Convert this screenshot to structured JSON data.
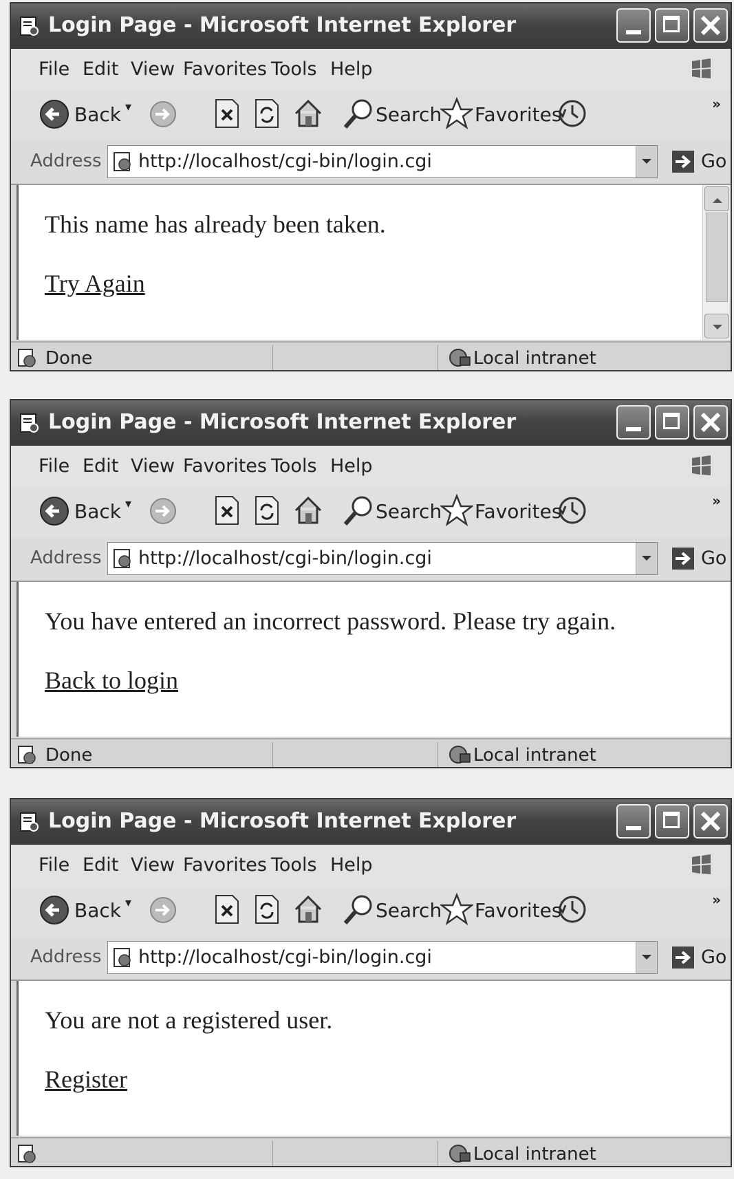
{
  "windows": [
    {
      "title": "Login Page - Microsoft Internet Explorer",
      "address_label": "Address",
      "url": "http://localhost/cgi-bin/login.cgi",
      "go_label": "Go",
      "message": "This name has already been taken.",
      "link_text": "Try Again",
      "status_text": "Done",
      "zone_text": "Local intranet"
    },
    {
      "title": "Login Page - Microsoft Internet Explorer",
      "address_label": "Address",
      "url": "http://localhost/cgi-bin/login.cgi",
      "go_label": "Go",
      "message": "You have entered an incorrect password. Please try again.",
      "link_text": "Back to login",
      "status_text": "Done",
      "zone_text": "Local intranet"
    },
    {
      "title": "Login Page - Microsoft Internet Explorer",
      "address_label": "Address",
      "url": "http://localhost/cgi-bin/login.cgi",
      "go_label": "Go",
      "message": "You are not a registered user.",
      "link_text": "Register",
      "status_text": "",
      "zone_text": "Local intranet"
    }
  ],
  "menu": [
    "File",
    "Edit",
    "View",
    "Favorites",
    "Tools",
    "Help"
  ],
  "toolbar": {
    "back_label": "Back",
    "search_label": "Search",
    "favorites_label": "Favorites",
    "chevron": "»"
  },
  "icons": [
    "ie-app-icon",
    "minimize-icon",
    "maximize-icon",
    "close-icon",
    "windows-logo-icon",
    "back-arrow-icon",
    "forward-arrow-icon",
    "stop-icon",
    "refresh-icon",
    "home-icon",
    "search-icon",
    "favorites-star-icon",
    "history-icon",
    "page-icon",
    "go-arrow-icon",
    "status-page-icon",
    "intranet-icon"
  ]
}
